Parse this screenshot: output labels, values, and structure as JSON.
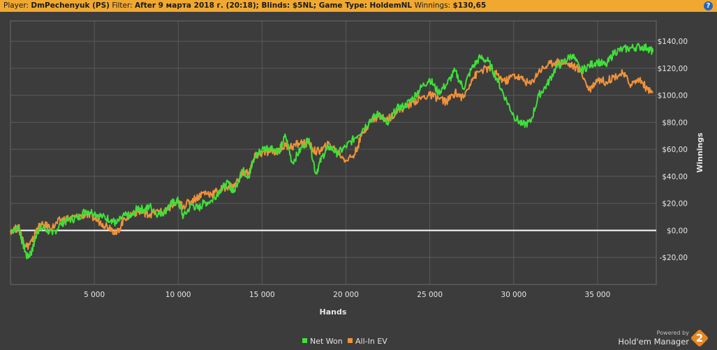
{
  "header": {
    "player_label": "Player:",
    "player_value": "DmPechenyuk (PS)",
    "filter_label": "Filter:",
    "filter_value": "After 9 марта 2018 г. (20:18); Blinds: $5NL; Game Type: HoldemNL",
    "winnings_label": "Winnings:",
    "winnings_value": "$130,65",
    "help_glyph": "?"
  },
  "branding": {
    "powered_by": "Powered by",
    "product": "Hold'em Manager",
    "badge_number": "2"
  },
  "colors": {
    "background": "#3c3c3c",
    "header": "#f0a830",
    "net_won": "#3fe03a",
    "all_in_ev": "#f0923a",
    "zero_line": "#ffffff",
    "grid": "#5a5a5a"
  },
  "chart_data": {
    "type": "line",
    "title": "",
    "xlabel": "Hands",
    "ylabel": "Winnings",
    "xlim": [
      0,
      38500
    ],
    "ylim": [
      -40,
      155
    ],
    "x_ticks": [
      5000,
      10000,
      15000,
      20000,
      25000,
      30000,
      35000
    ],
    "x_tick_labels": [
      "5 000",
      "10 000",
      "15 000",
      "20 000",
      "25 000",
      "30 000",
      "35 000"
    ],
    "y_ticks": [
      -20,
      0,
      20,
      40,
      60,
      80,
      100,
      120,
      140
    ],
    "y_tick_labels": [
      "-$20,00",
      "$0,00",
      "$20,00",
      "$40,00",
      "$60,00",
      "$80,00",
      "$100,00",
      "$120,00",
      "$140,00"
    ],
    "grid": true,
    "legend_position": "bottom-center",
    "series": [
      {
        "name": "Net Won",
        "color": "#3fe03a",
        "x": [
          0,
          500,
          700,
          1000,
          1300,
          1600,
          2000,
          2500,
          3000,
          3500,
          4000,
          4500,
          5000,
          5500,
          6000,
          6300,
          6800,
          7200,
          7600,
          8000,
          8300,
          8800,
          9200,
          9600,
          10000,
          10300,
          10800,
          11200,
          11500,
          12000,
          12500,
          13000,
          13300,
          13800,
          14200,
          14600,
          15000,
          15500,
          16000,
          16400,
          16800,
          17300,
          17800,
          18200,
          18600,
          19000,
          19500,
          20000,
          20500,
          21000,
          21500,
          22000,
          22500,
          23000,
          23500,
          24000,
          24500,
          25000,
          25500,
          26000,
          26500,
          27000,
          27500,
          28000,
          28500,
          29000,
          29500,
          30000,
          30500,
          31000,
          31500,
          32000,
          32500,
          33000,
          33500,
          34000,
          34500,
          35000,
          35500,
          36000,
          36500,
          37000,
          37500,
          38000,
          38300
        ],
        "y": [
          0,
          2,
          -8,
          -20,
          -15,
          0,
          2,
          -3,
          5,
          8,
          9,
          15,
          13,
          10,
          8,
          5,
          11,
          10,
          17,
          15,
          18,
          12,
          14,
          20,
          22,
          10,
          19,
          16,
          20,
          22,
          30,
          35,
          28,
          45,
          40,
          55,
          60,
          62,
          58,
          70,
          50,
          60,
          68,
          42,
          55,
          62,
          57,
          62,
          68,
          75,
          82,
          87,
          78,
          90,
          92,
          98,
          106,
          112,
          102,
          108,
          118,
          105,
          120,
          128,
          125,
          112,
          98,
          85,
          78,
          80,
          100,
          108,
          120,
          125,
          130,
          118,
          122,
          125,
          122,
          132,
          134,
          135,
          136,
          135,
          132
        ]
      },
      {
        "name": "All-In EV",
        "color": "#f0923a",
        "x": [
          0,
          500,
          700,
          1000,
          1300,
          1600,
          2000,
          2500,
          3000,
          3500,
          4000,
          4500,
          5000,
          5500,
          6000,
          6300,
          6800,
          7200,
          7600,
          8000,
          8300,
          8800,
          9200,
          9600,
          10000,
          10300,
          10800,
          11200,
          11500,
          12000,
          12500,
          13000,
          13300,
          13800,
          14200,
          14600,
          15000,
          15500,
          16000,
          16400,
          16800,
          17300,
          17800,
          18200,
          18600,
          19000,
          19500,
          20000,
          20500,
          21000,
          21500,
          22000,
          22500,
          23000,
          23500,
          24000,
          24500,
          25000,
          25500,
          26000,
          26500,
          27000,
          27500,
          28000,
          28500,
          29000,
          29500,
          30000,
          30500,
          31000,
          31500,
          32000,
          32500,
          33000,
          33500,
          34000,
          34500,
          35000,
          35500,
          36000,
          36500,
          37000,
          37500,
          38000,
          38300
        ],
        "y": [
          0,
          2,
          -6,
          -12,
          -8,
          2,
          4,
          2,
          8,
          9,
          10,
          12,
          9,
          5,
          2,
          -3,
          9,
          12,
          14,
          13,
          12,
          14,
          13,
          18,
          20,
          18,
          22,
          25,
          28,
          27,
          30,
          33,
          32,
          42,
          43,
          55,
          57,
          58,
          59,
          63,
          62,
          65,
          64,
          58,
          60,
          64,
          58,
          52,
          56,
          72,
          82,
          84,
          82,
          88,
          91,
          95,
          98,
          100,
          98,
          95,
          102,
          98,
          112,
          118,
          120,
          115,
          110,
          115,
          112,
          108,
          118,
          122,
          125,
          124,
          122,
          118,
          104,
          112,
          110,
          114,
          116,
          108,
          112,
          104,
          102
        ]
      }
    ]
  }
}
